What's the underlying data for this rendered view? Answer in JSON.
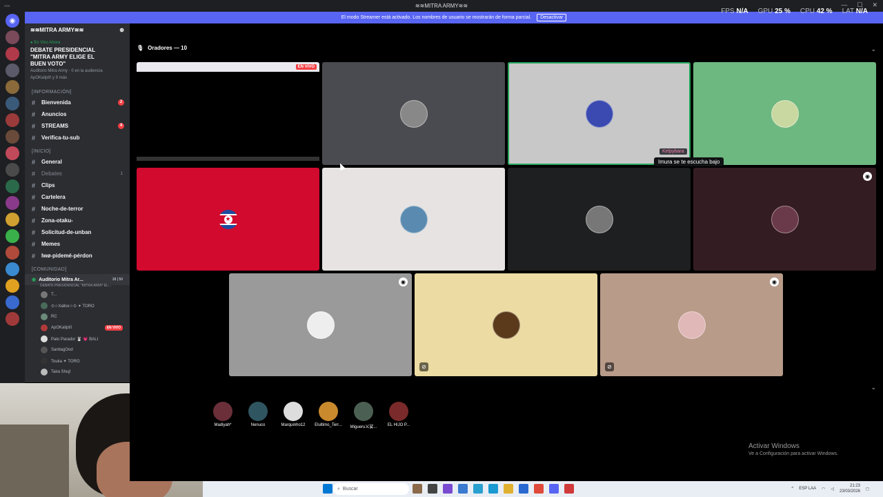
{
  "window": {
    "title": "≋≋MITRA ARMY≋≋",
    "perf": [
      {
        "label": "FPS",
        "value": "N/A"
      },
      {
        "label": "GPU",
        "value": "25 %"
      },
      {
        "label": "CPU",
        "value": "42 %"
      },
      {
        "label": "LAT",
        "value": "N/A"
      }
    ]
  },
  "banner": {
    "text": "El modo Streamer está activado. Los nombres de usuario se mostrarán de forma parcial.",
    "button": "Desactivar"
  },
  "server": {
    "name": "≋≋MITRA ARMY≋≋",
    "live_now": "● En Vivo Ahora",
    "event_title": "DEBATE PRESIDENCIAL \"MITRA ARMY ELIGE EL BUEN VOTO\"",
    "event_meta": "Auditorio Mitra Army · 0 en la audiencia",
    "event_meta2": "ApOKalipt0 y 9 más"
  },
  "categories": [
    {
      "name": "[INFORMACIÓN]",
      "channels": [
        {
          "label": "Bienvenida",
          "badge": "2",
          "muted": false,
          "icon": "hash"
        },
        {
          "label": "Anuncios",
          "badge": "",
          "muted": false,
          "icon": "hash"
        },
        {
          "label": "STREAMS",
          "badge": "4",
          "muted": false,
          "icon": "hash"
        },
        {
          "label": "Verifica-tu-sub",
          "badge": "",
          "muted": false,
          "icon": "hash"
        }
      ]
    },
    {
      "name": "[INICIO]",
      "channels": [
        {
          "label": "General",
          "badge": "",
          "muted": false,
          "icon": "hash"
        },
        {
          "label": "Debates",
          "badge": "",
          "muted": true,
          "icon": "hash",
          "count": "1"
        },
        {
          "label": "Clips",
          "badge": "",
          "muted": false,
          "icon": "hash"
        },
        {
          "label": "Cartelera",
          "badge": "",
          "muted": false,
          "icon": "hash"
        },
        {
          "label": "Noche-de-terror",
          "badge": "",
          "muted": false,
          "icon": "hash"
        },
        {
          "label": "Zona-otaku-",
          "badge": "",
          "muted": false,
          "icon": "hash"
        },
        {
          "label": "Solicitud-de-unban",
          "badge": "",
          "muted": false,
          "icon": "hash"
        },
        {
          "label": "Memes",
          "badge": "",
          "muted": false,
          "icon": "hash"
        },
        {
          "label": "Iwø-pidemé-pérdon",
          "badge": "",
          "muted": false,
          "icon": "hash"
        }
      ]
    },
    {
      "name": "[COMUNIDAD]",
      "channels": []
    }
  ],
  "voice_channel": {
    "label": "Auditorio Mitra Ar...",
    "counts": "18 | 50",
    "subtitle": "DEBATE PRESIDENCIAL \"MITRA ARMY EL...",
    "members": [
      {
        "name": "T...",
        "live": ""
      },
      {
        "name": "⊙☆Xallox☆⊙ ✦ TORO",
        "live": ""
      },
      {
        "name": "RC",
        "live": ""
      },
      {
        "name": "ApOKalipt0",
        "live": "EN VIVO"
      },
      {
        "name": "Pato Parador 🐰 💗 BALI",
        "live": ""
      },
      {
        "name": "SantiagOod",
        "live": ""
      },
      {
        "name": "Touka ✦ TORO",
        "live": ""
      },
      {
        "name": "Taira Shujl",
        "live": ""
      }
    ]
  },
  "stage": {
    "speakers_label": "Oradores — 10",
    "screen_live": "EN VIVO",
    "tooltip_name": "Kelpybara",
    "tooltip_text": "Imura se te escucha bajo",
    "tile_colors": [
      "#4a4b50",
      "#c8c8c8",
      "#6db780",
      "#d10a2e",
      "#e6e3e2",
      "#1e1f20",
      "#341d22",
      "#9a9a9a",
      "#ecdba3",
      "#b99b8a"
    ],
    "audience": [
      {
        "name": "Madiyah*",
        "color": "#6b2f3a"
      },
      {
        "name": "Nenuco",
        "color": "#2f5660"
      },
      {
        "name": "Marquinho12",
        "color": "#ddd"
      },
      {
        "name": "Elultimo_Terr...",
        "color": "#c98a2e"
      },
      {
        "name": "Migueru乂娑...",
        "color": "#4b6052"
      },
      {
        "name": "EL HIJO P...",
        "color": "#7a2a2a"
      }
    ]
  },
  "windows_notice": {
    "title": "Activar Windows",
    "sub": "Ve a Configuración para activar Windows."
  },
  "taskbar": {
    "search": "Buscar",
    "lang": "ESP LAA",
    "time": "21:23",
    "date": "23/03/2026"
  }
}
